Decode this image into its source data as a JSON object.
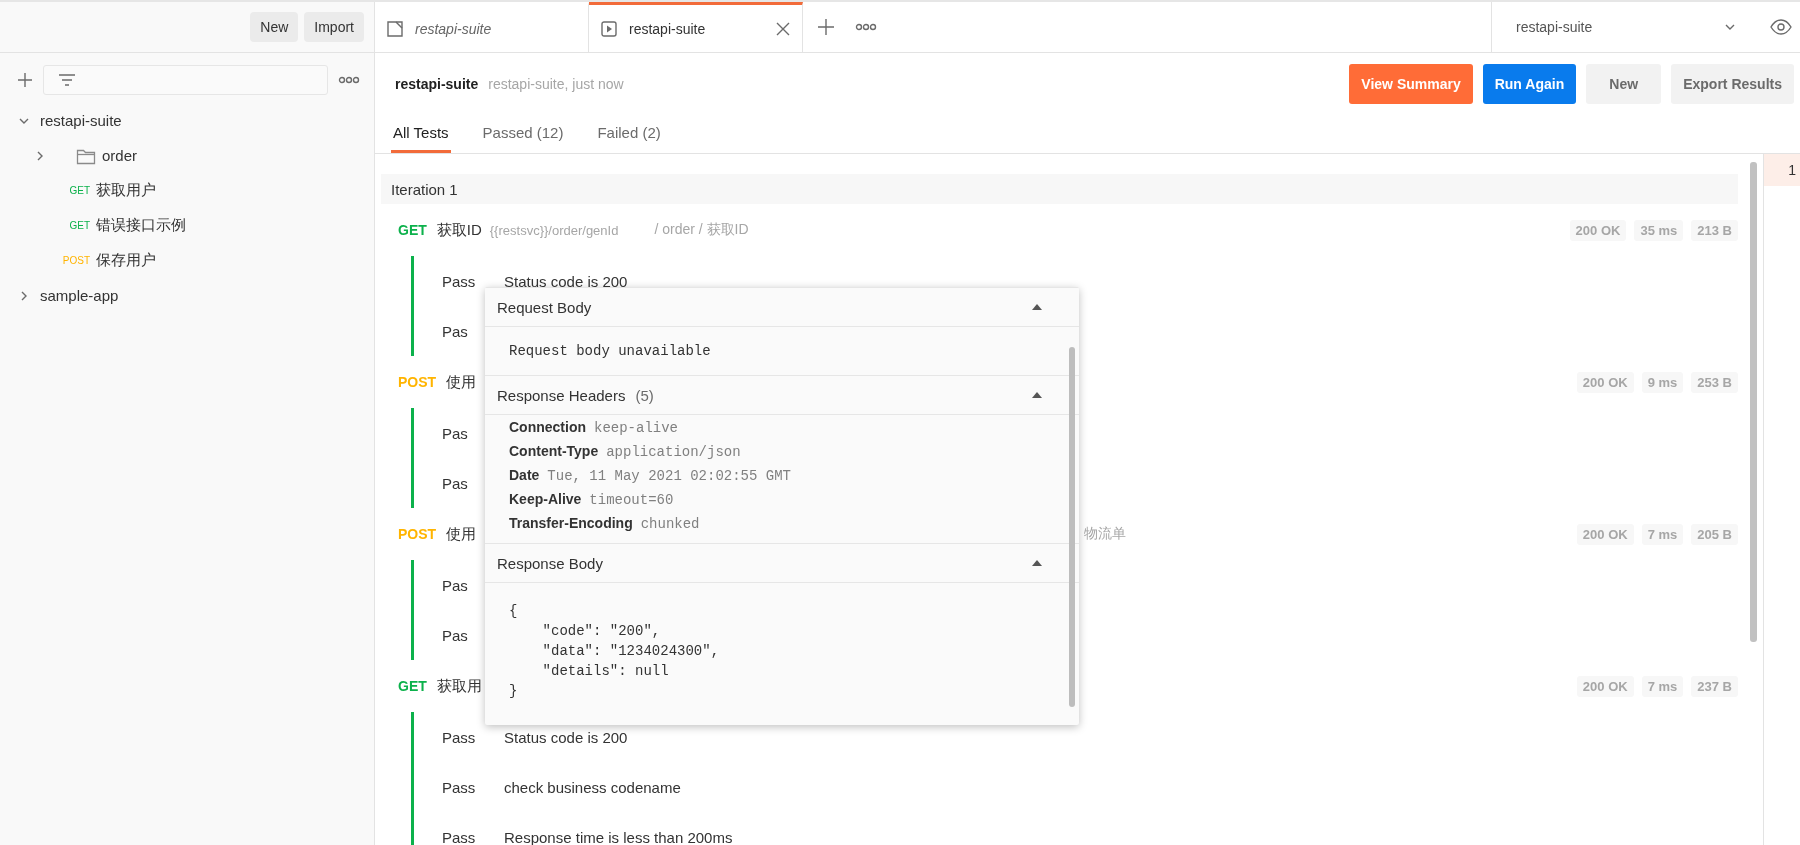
{
  "sidebar": {
    "buttons": [
      "New",
      "Import"
    ],
    "tree": [
      {
        "kind": "collection",
        "name": "restapi-suite",
        "expanded": true,
        "children": [
          {
            "kind": "folder",
            "name": "order",
            "expanded": false
          },
          {
            "kind": "request",
            "method": "GET",
            "name": "获取用户"
          },
          {
            "kind": "request",
            "method": "GET",
            "name": "错误接口示例"
          },
          {
            "kind": "request",
            "method": "POST",
            "name": "保存用户"
          }
        ]
      },
      {
        "kind": "collection",
        "name": "sample-app",
        "expanded": false
      }
    ]
  },
  "tabs": [
    {
      "label": "restapi-suite",
      "kind": "collection",
      "preview": true,
      "selected": false
    },
    {
      "label": "restapi-suite",
      "kind": "runner",
      "preview": false,
      "selected": true
    }
  ],
  "environment": "restapi-suite",
  "run": {
    "title": "restapi-suite",
    "subtitle": "restapi-suite, just now",
    "buttons": [
      {
        "label": "View Summary",
        "kind": "summary"
      },
      {
        "label": "Run Again",
        "kind": "rerun"
      },
      {
        "label": "New",
        "kind": "new"
      },
      {
        "label": "Export Results",
        "kind": "export"
      }
    ]
  },
  "result_tabs": [
    {
      "label": "All Tests",
      "selected": true
    },
    {
      "label": "Passed (12)",
      "selected": false
    },
    {
      "label": "Failed (2)",
      "selected": false
    }
  ],
  "iteration": "Iteration 1",
  "requests": [
    {
      "method": "GET",
      "name": "获取ID",
      "url": "{{restsvc}}/order/genId",
      "path": "/ order / 获取ID",
      "status": "200 OK",
      "time": "35 ms",
      "size": "213 B",
      "tests": [
        {
          "result": "Pass",
          "name": "Status code is 200"
        },
        {
          "result": "Pas"
        }
      ]
    },
    {
      "method": "POST",
      "name": "使用",
      "status": "200 OK",
      "time": "9 ms",
      "size": "253 B",
      "tests": [
        {
          "result": "Pas"
        },
        {
          "result": "Pas"
        }
      ]
    },
    {
      "method": "POST",
      "name": "使用",
      "path": "物流单",
      "status": "200 OK",
      "time": "7 ms",
      "size": "205 B",
      "tests": [
        {
          "result": "Pas"
        },
        {
          "result": "Pas"
        }
      ]
    },
    {
      "method": "GET",
      "name": "获取用",
      "status": "200 OK",
      "time": "7 ms",
      "size": "237 B",
      "tests": [
        {
          "result": "Pass",
          "name": "Status code is 200"
        },
        {
          "result": "Pass",
          "name": "check business codename"
        },
        {
          "result": "Pass",
          "name": "Response time is less than 200ms"
        }
      ]
    }
  ],
  "details_popup": {
    "sections": [
      {
        "kind": "text",
        "title": "Request Body",
        "expanded": true,
        "body": "Request body unavailable"
      },
      {
        "kind": "headers",
        "title": "Response Headers",
        "count": "(5)",
        "expanded": true,
        "headers": [
          {
            "key": "Connection",
            "value": "keep-alive"
          },
          {
            "key": "Content-Type",
            "value": "application/json"
          },
          {
            "key": "Date",
            "value": "Tue, 11 May 2021 02:02:55 GMT"
          },
          {
            "key": "Keep-Alive",
            "value": "timeout=60"
          },
          {
            "key": "Transfer-Encoding",
            "value": "chunked"
          }
        ]
      },
      {
        "kind": "code",
        "title": "Response Body",
        "expanded": true,
        "lines": [
          "{",
          "    \"code\": \"200\",",
          "    \"data\": \"1234024300\",",
          "    \"details\": null",
          "}"
        ]
      }
    ]
  },
  "right_panel": {
    "marker": "1"
  }
}
